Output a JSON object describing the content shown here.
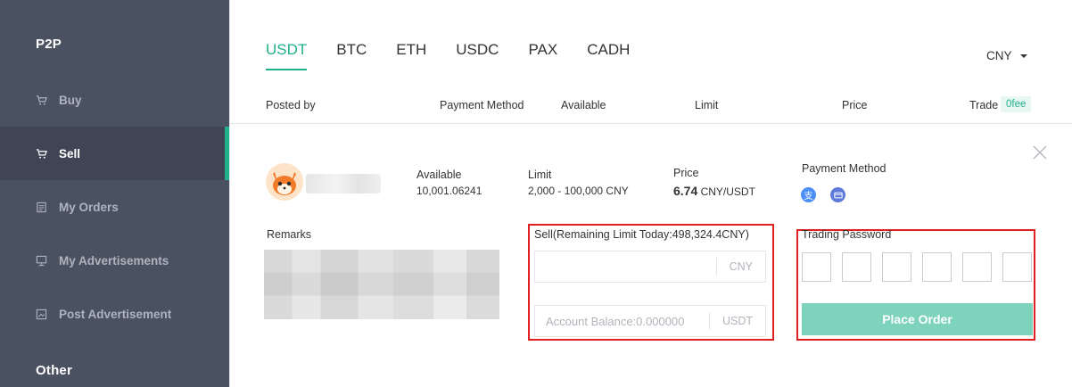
{
  "sidebar": {
    "section_p2p": "P2P",
    "items": [
      {
        "label": "Buy",
        "icon": "cart-icon"
      },
      {
        "label": "Sell",
        "icon": "cart-icon"
      },
      {
        "label": "My Orders",
        "icon": "document-icon"
      },
      {
        "label": "My Advertisements",
        "icon": "monitor-icon"
      },
      {
        "label": "Post Advertisement",
        "icon": "image-edit-icon"
      }
    ],
    "section_other": "Other"
  },
  "tabs": [
    "USDT",
    "BTC",
    "ETH",
    "USDC",
    "PAX",
    "CADH"
  ],
  "active_tab": "USDT",
  "currency_selector": "CNY",
  "table_header": {
    "posted_by": "Posted by",
    "payment_method": "Payment Method",
    "available": "Available",
    "limit": "Limit",
    "price": "Price",
    "trade": "Trade",
    "fee_badge": "0fee"
  },
  "order": {
    "available_label": "Available",
    "available_value": "10,001.06241",
    "limit_label": "Limit",
    "limit_value": "2,000 - 100,000 CNY",
    "price_label": "Price",
    "price_value": "6.74",
    "price_unit": "CNY/USDT",
    "payment_method_label": "Payment Method",
    "payment_icons": [
      "alipay-icon",
      "bank-card-icon"
    ],
    "alipay_glyph": "支",
    "remarks_label": "Remarks"
  },
  "sell_form": {
    "label": "Sell(Remaining Limit Today:498,324.4CNY)",
    "amount_placeholder": "",
    "amount_unit": "CNY",
    "balance_placeholder": "Account Balance:0.000000",
    "balance_unit": "USDT"
  },
  "trading_password": {
    "label": "Trading Password",
    "cells": 6
  },
  "place_order_label": "Place Order",
  "colors": {
    "accent": "#1fb18a",
    "sidebar_bg": "#4a5161",
    "button_bg": "#7dd3bb",
    "annotation_red": "#e02020"
  }
}
